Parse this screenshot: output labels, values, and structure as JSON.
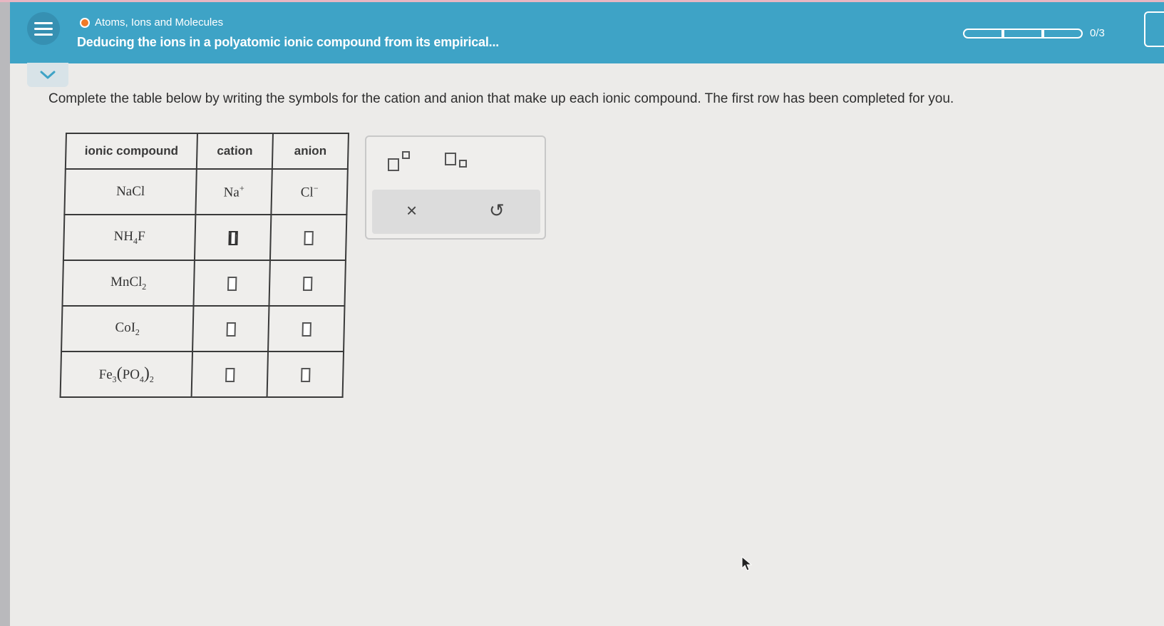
{
  "header": {
    "topic": "Atoms, Ions and Molecules",
    "title": "Deducing the ions in a polyatomic ionic compound from its empirical...",
    "progress": {
      "completed": 0,
      "total": 3,
      "label": "0/3"
    }
  },
  "instructions": "Complete the table below by writing the symbols for the cation and anion that make up each ionic compound. The first row has been completed for you.",
  "table": {
    "headers": [
      "ionic compound",
      "cation",
      "anion"
    ],
    "rows": [
      {
        "compound": "NaCl",
        "cation": "Na",
        "cation_charge": "+",
        "anion": "Cl",
        "anion_charge": "−"
      },
      {
        "compound_main": "NH",
        "compound_sub": "4",
        "compound_tail": "F"
      },
      {
        "compound_main": "MnCl",
        "compound_sub": "2"
      },
      {
        "compound_main": "CoI",
        "compound_sub": "2"
      },
      {
        "compound_main": "Fe",
        "compound_sub": "3",
        "compound_paren_open": "(",
        "compound_inner": "PO",
        "compound_inner_sub": "4",
        "compound_paren_close": ")",
        "compound_outer_sub": "2"
      }
    ]
  },
  "palette": {
    "superscript_icon": "superscript-template-icon",
    "subscript_icon": "subscript-template-icon",
    "clear_label": "×",
    "undo_label": "↺"
  },
  "colors": {
    "header": "#3ea3c6",
    "topic_dot": "#f07a27"
  }
}
